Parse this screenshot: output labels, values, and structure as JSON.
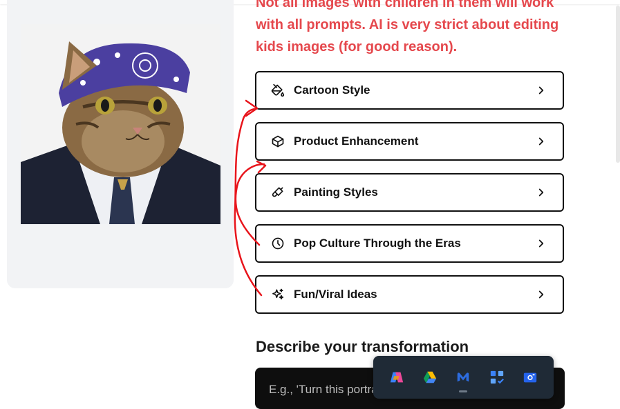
{
  "warning": {
    "text": "Not all images with children in them will work with all prompts. AI is very strict about editing kids images (for good reason)."
  },
  "menu": [
    {
      "label": "Cartoon Style",
      "icon": "paint-bucket-icon"
    },
    {
      "label": "Product Enhancement",
      "icon": "box-icon"
    },
    {
      "label": "Painting Styles",
      "icon": "brush-icon"
    },
    {
      "label": "Pop Culture Through the Eras",
      "icon": "clock-icon"
    },
    {
      "label": "Fun/Viral Ideas",
      "icon": "sparkles-icon"
    }
  ],
  "transform": {
    "title": "Describe your transformation",
    "placeholder": "E.g., 'Turn this portrait into a watercolor painting'"
  },
  "taskbar": {
    "items": [
      "copilot-icon",
      "google-drive-icon",
      "malwarebytes-icon",
      "todo-icon",
      "camera-icon"
    ]
  },
  "colors": {
    "warning": "#e5484d",
    "annotation": "#e8141b",
    "taskbar": "#1f2a36"
  }
}
